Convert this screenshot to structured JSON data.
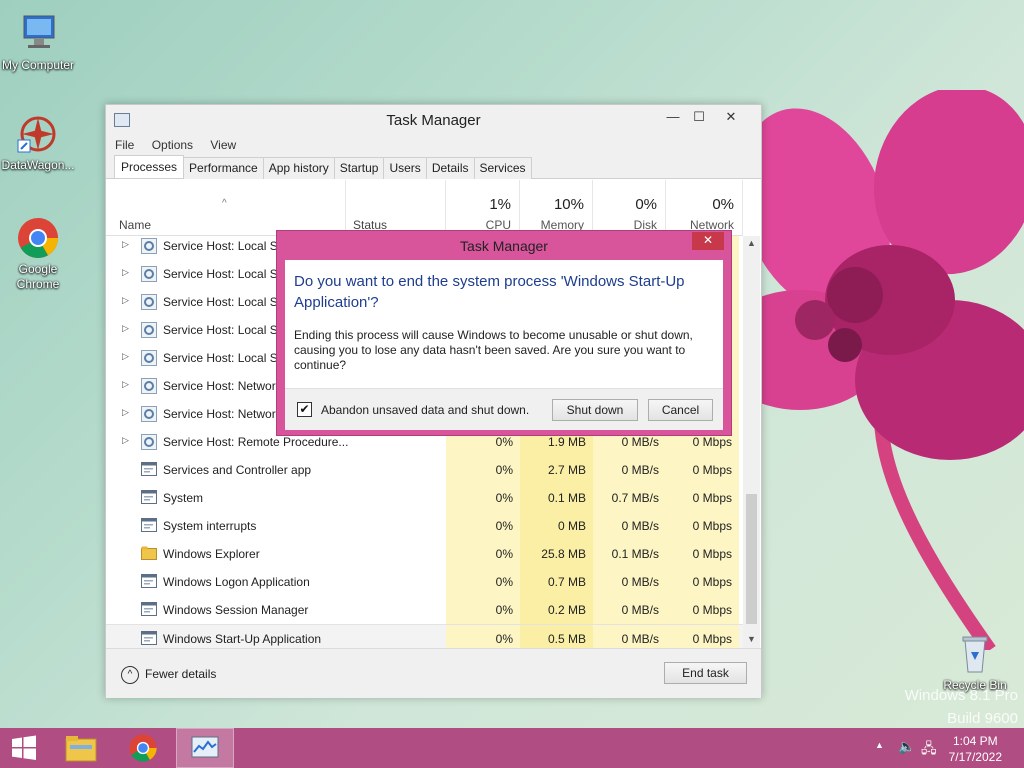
{
  "desktop": {
    "icons": [
      {
        "label": "My Computer"
      },
      {
        "label": "DataWagon..."
      },
      {
        "label": "Google Chrome"
      },
      {
        "label": "Recycle Bin"
      }
    ],
    "watermark_line1": "Windows 8.1 Pro",
    "watermark_line2": "Build 9600"
  },
  "task_manager": {
    "title": "Task Manager",
    "menu": [
      "File",
      "Options",
      "View"
    ],
    "tabs": [
      "Processes",
      "Performance",
      "App history",
      "Startup",
      "Users",
      "Details",
      "Services"
    ],
    "active_tab": "Processes",
    "columns": {
      "name": "Name",
      "status": "Status",
      "cpu_pct": "1%",
      "cpu": "CPU",
      "mem_pct": "10%",
      "mem": "Memory",
      "disk_pct": "0%",
      "disk": "Disk",
      "net_pct": "0%",
      "net": "Network"
    },
    "rows": [
      {
        "name": "Service Host: Local Se",
        "expand": true,
        "cpu": "",
        "mem": "",
        "disk": "",
        "net": ""
      },
      {
        "name": "Service Host: Local Se",
        "expand": true,
        "cpu": "",
        "mem": "",
        "disk": "",
        "net": ""
      },
      {
        "name": "Service Host: Local Se",
        "expand": true,
        "cpu": "",
        "mem": "",
        "disk": "",
        "net": ""
      },
      {
        "name": "Service Host: Local Sy",
        "expand": true,
        "cpu": "",
        "mem": "",
        "disk": "",
        "net": ""
      },
      {
        "name": "Service Host: Local Sy",
        "expand": true,
        "cpu": "",
        "mem": "",
        "disk": "",
        "net": ""
      },
      {
        "name": "Service Host: Network",
        "expand": true,
        "cpu": "",
        "mem": "",
        "disk": "",
        "net": ""
      },
      {
        "name": "Service Host: Network",
        "expand": true,
        "cpu": "",
        "mem": "",
        "disk": "",
        "net": ""
      },
      {
        "name": "Service Host: Remote Procedure...",
        "expand": true,
        "cpu": "0%",
        "mem": "1.9 MB",
        "disk": "0 MB/s",
        "net": "0 Mbps"
      },
      {
        "name": "Services and Controller app",
        "expand": false,
        "cpu": "0%",
        "mem": "2.7 MB",
        "disk": "0 MB/s",
        "net": "0 Mbps"
      },
      {
        "name": "System",
        "expand": false,
        "cpu": "0%",
        "mem": "0.1 MB",
        "disk": "0.7 MB/s",
        "net": "0 Mbps"
      },
      {
        "name": "System interrupts",
        "expand": false,
        "cpu": "0%",
        "mem": "0 MB",
        "disk": "0 MB/s",
        "net": "0 Mbps"
      },
      {
        "name": "Windows Explorer",
        "expand": false,
        "cpu": "0%",
        "mem": "25.8 MB",
        "disk": "0.1 MB/s",
        "net": "0 Mbps"
      },
      {
        "name": "Windows Logon Application",
        "expand": false,
        "cpu": "0%",
        "mem": "0.7 MB",
        "disk": "0 MB/s",
        "net": "0 Mbps"
      },
      {
        "name": "Windows Session Manager",
        "expand": false,
        "cpu": "0%",
        "mem": "0.2 MB",
        "disk": "0 MB/s",
        "net": "0 Mbps"
      },
      {
        "name": "Windows Start-Up Application",
        "expand": false,
        "cpu": "0%",
        "mem": "0.5 MB",
        "disk": "0 MB/s",
        "net": "0 Mbps"
      }
    ],
    "fewer_details": "Fewer details",
    "end_task": "End task"
  },
  "dialog": {
    "title": "Task Manager",
    "close": "✕",
    "question": "Do you want to end the system process 'Windows Start-Up Application'?",
    "message": "Ending this process will cause Windows to become unusable or shut down, causing you to lose any data hasn't been saved. Are you sure you want to continue?",
    "checkbox_label": "Abandon unsaved data and shut down.",
    "checkbox_checked": true,
    "shutdown": "Shut down",
    "cancel": "Cancel"
  },
  "taskbar": {
    "time": "1:04 PM",
    "date": "7/17/2022"
  }
}
